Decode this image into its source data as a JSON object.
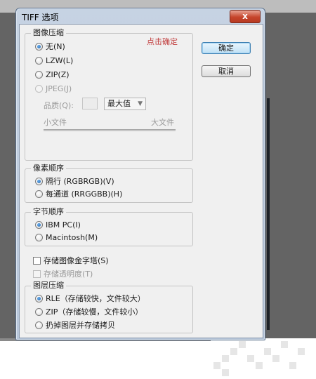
{
  "window": {
    "title": "TIFF 选项",
    "close_glyph": "x"
  },
  "annotation": "点击确定",
  "buttons": {
    "ok": "确定",
    "cancel": "取消"
  },
  "image_compression": {
    "legend": "图像压缩",
    "options": [
      "无(N)",
      "LZW(L)",
      "ZIP(Z)",
      "JPEG(J)"
    ],
    "selected": "无(N)",
    "quality_label": "品质(Q):",
    "quality_select": "最大值",
    "small_file": "小文件",
    "large_file": "大文件"
  },
  "pixel_order": {
    "legend": "像素顺序",
    "options": [
      "隔行 (RGBRGB)(V)",
      "每通道 (RRGGBB)(H)"
    ],
    "selected": "隔行 (RGBRGB)(V)"
  },
  "byte_order": {
    "legend": "字节顺序",
    "options": [
      "IBM PC(I)",
      "Macintosh(M)"
    ],
    "selected": "IBM PC(I)"
  },
  "checkboxes": {
    "save_pyramid": "存储图像金字塔(S)",
    "save_transparency": "存储透明度(T)"
  },
  "layer_compression": {
    "legend": "图层压缩",
    "options": [
      "RLE（存储较快，文件较大）",
      "ZIP（存储较慢，文件较小）",
      "扔掉图层并存储拷贝"
    ],
    "selected": "RLE（存储较快，文件较大）"
  },
  "colors": {
    "annotation": "#c03a3a",
    "close_button": "#c6452b",
    "default_button_border": "#3c7fb1"
  }
}
